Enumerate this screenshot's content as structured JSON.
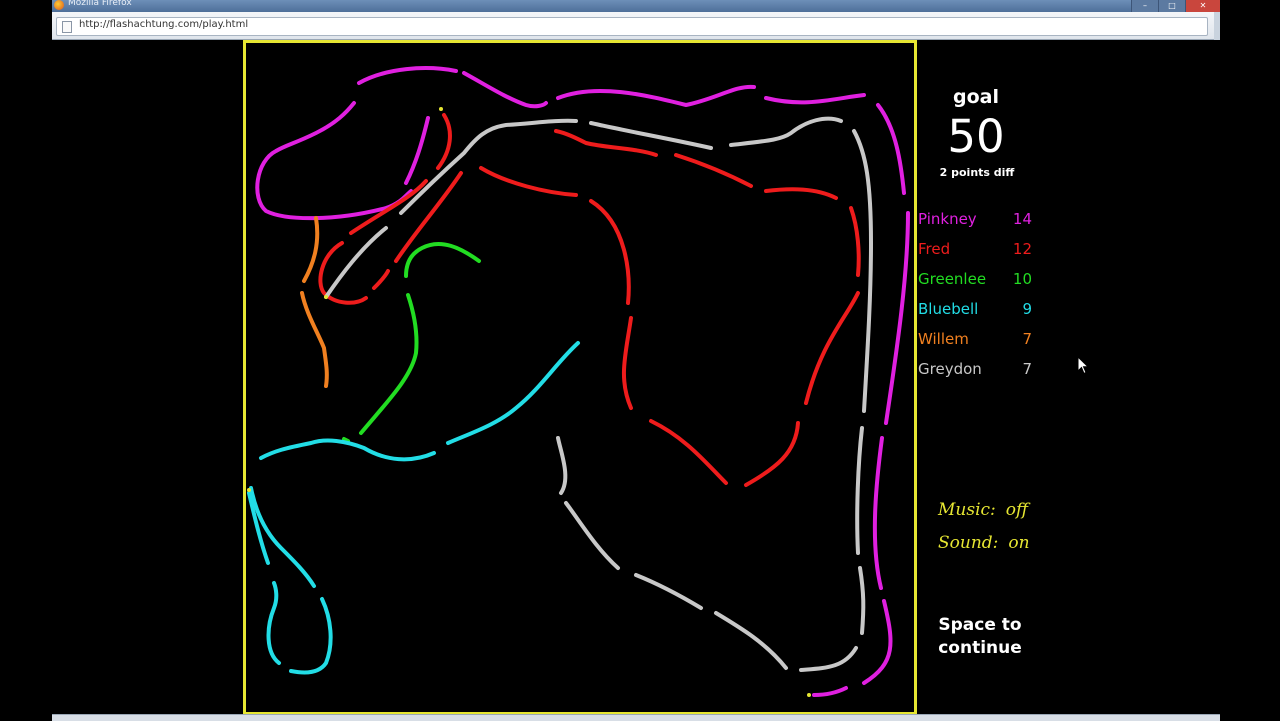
{
  "window": {
    "title": "Mozilla Firefox",
    "url": "http://flashachtung.com/play.html"
  },
  "game": {
    "goal_label": "goal",
    "goal_value": "50",
    "points_diff": "2 points diff",
    "players": [
      {
        "name": "Pinkney",
        "score": "14",
        "color": "#e020e0"
      },
      {
        "name": "Fred",
        "score": "12",
        "color": "#ee1c1c"
      },
      {
        "name": "Greenlee",
        "score": "10",
        "color": "#22dd22"
      },
      {
        "name": "Bluebell",
        "score": "9",
        "color": "#22dde6"
      },
      {
        "name": "Willem",
        "score": "7",
        "color": "#f08020"
      },
      {
        "name": "Greydon",
        "score": "7",
        "color": "#c8c8c8"
      }
    ],
    "music_label": "Music:",
    "music_value": "off",
    "sound_label": "Sound:",
    "sound_value": "on",
    "continue_line1": "Space to",
    "continue_line2": "continue",
    "border_color": "#e6e632"
  }
}
